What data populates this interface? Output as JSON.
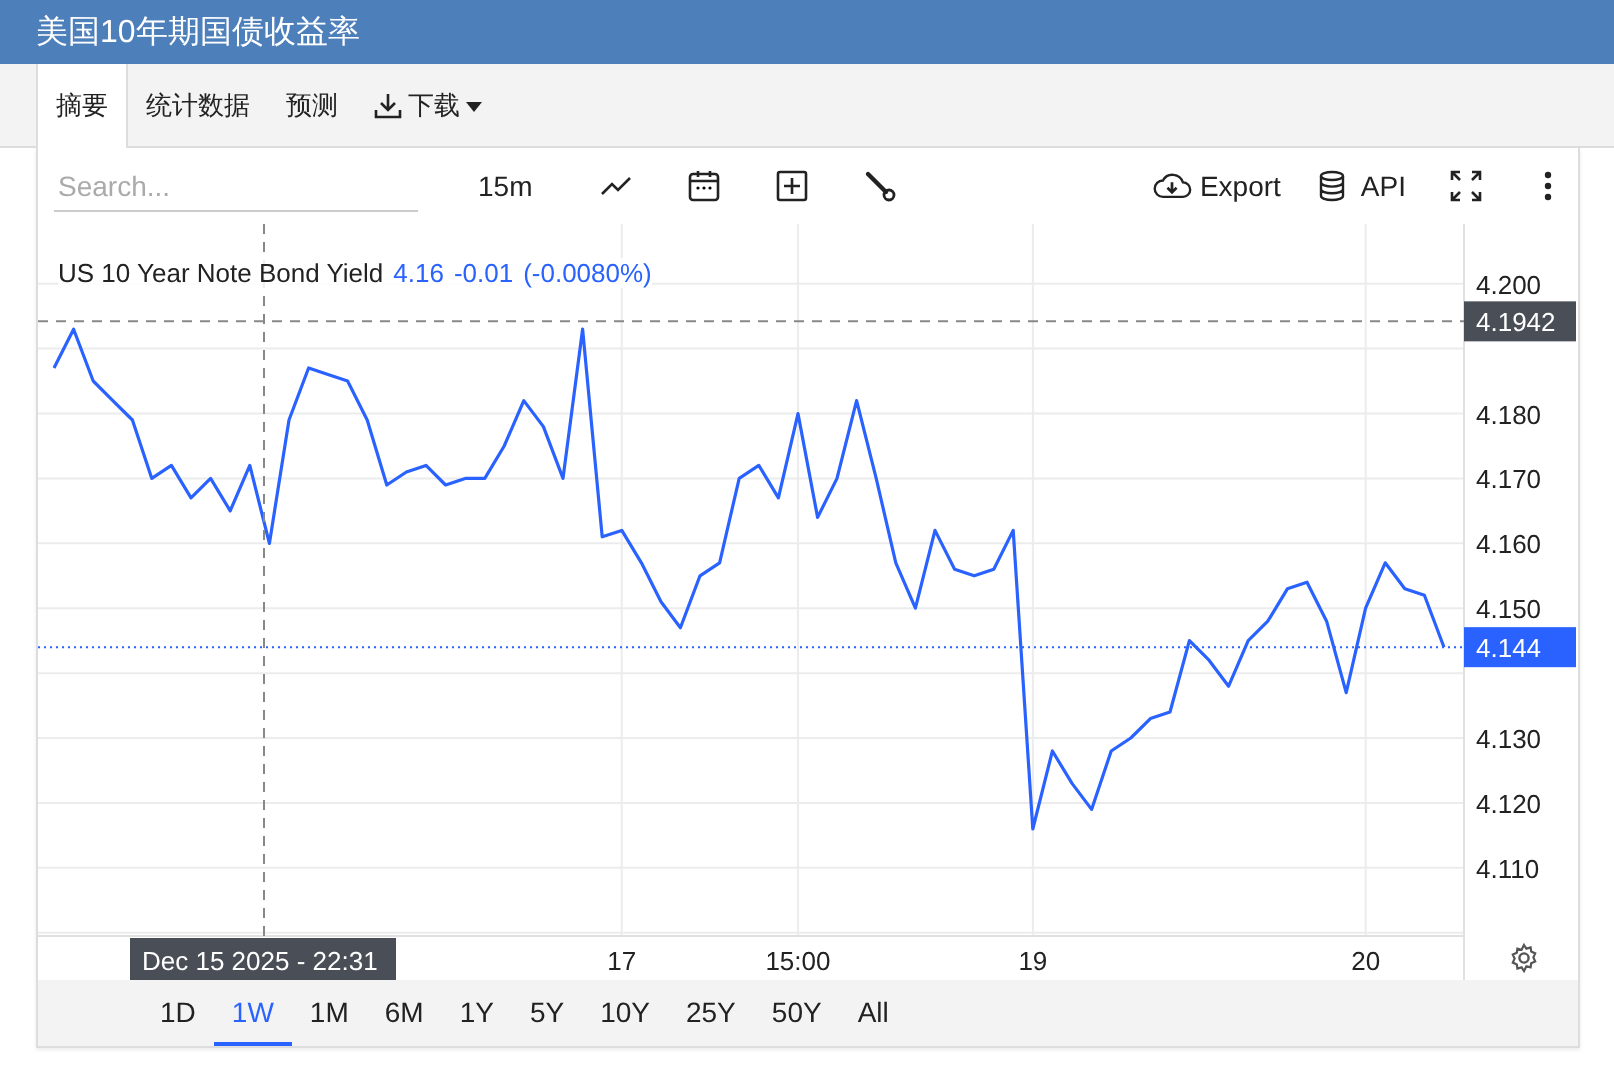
{
  "header": {
    "title": "美国10年期国债收益率"
  },
  "tabs": [
    {
      "label": "摘要",
      "selected": true
    },
    {
      "label": "统计数据",
      "selected": false
    },
    {
      "label": "预测",
      "selected": false
    },
    {
      "label": "下载",
      "selected": false,
      "kind": "download"
    }
  ],
  "toolbar": {
    "search": {
      "placeholder": "Search..."
    },
    "interval": "15m",
    "export": "Export",
    "api": "API"
  },
  "legend": {
    "name": "US 10 Year Note Bond Yield",
    "value": "4.16",
    "change": "-0.01",
    "change_pct": "(-0.0080%)"
  },
  "crosshair": {
    "time": "Dec 15 2025 - 22:31"
  },
  "chart_data": {
    "type": "line",
    "grid": true,
    "ylim": [
      4.0995,
      4.2092
    ],
    "yticks": [
      {
        "value": 4.11,
        "label": "4.110"
      },
      {
        "value": 4.12,
        "label": "4.120"
      },
      {
        "value": 4.13,
        "label": "4.130"
      },
      {
        "value": 4.15,
        "label": "4.150"
      },
      {
        "value": 4.16,
        "label": "4.160"
      },
      {
        "value": 4.17,
        "label": "4.170"
      },
      {
        "value": 4.18,
        "label": "4.180"
      },
      {
        "value": 4.2,
        "label": "4.200"
      }
    ],
    "ref_lines": [
      {
        "axis": "y",
        "value": 4.1942,
        "label": "4.1942",
        "color": "#888888"
      },
      {
        "axis": "y",
        "value": 4.144,
        "label": "4.144",
        "color": "#2962ff"
      }
    ],
    "categories": [
      null,
      null,
      null,
      null,
      null,
      null,
      null,
      null,
      null,
      null,
      null,
      null,
      null,
      null,
      null,
      null,
      null,
      null,
      null,
      null,
      null,
      null,
      null,
      null,
      null,
      null,
      null,
      null,
      null,
      "17",
      null,
      null,
      null,
      null,
      null,
      null,
      null,
      null,
      "15:00",
      null,
      null,
      null,
      null,
      null,
      null,
      null,
      null,
      null,
      null,
      null,
      "19",
      null,
      null,
      null,
      null,
      null,
      null,
      null,
      null,
      null,
      null,
      null,
      null,
      null,
      null,
      null,
      null,
      "20",
      null,
      null,
      null,
      null
    ],
    "series": [
      {
        "color": "#2962ff",
        "values": [
          4.187,
          4.193,
          4.185,
          4.182,
          4.179,
          4.17,
          4.172,
          4.167,
          4.17,
          4.165,
          4.172,
          4.16,
          4.179,
          4.187,
          4.186,
          4.185,
          4.179,
          4.169,
          4.171,
          4.172,
          4.169,
          4.17,
          4.17,
          4.175,
          4.182,
          4.178,
          4.17,
          4.193,
          4.161,
          4.162,
          4.157,
          4.151,
          4.147,
          4.155,
          4.157,
          4.17,
          4.172,
          4.167,
          4.18,
          4.164,
          4.17,
          4.182,
          4.17,
          4.157,
          4.15,
          4.162,
          4.156,
          4.155,
          4.156,
          4.162,
          4.116,
          4.128,
          4.123,
          4.119,
          4.128,
          4.13,
          4.133,
          4.134,
          4.145,
          4.142,
          4.138,
          4.145,
          4.148,
          4.153,
          4.154,
          4.148,
          4.137,
          4.15,
          4.157,
          4.153,
          4.152,
          4.144
        ]
      }
    ]
  },
  "ranges": [
    {
      "label": "1D",
      "selected": false
    },
    {
      "label": "1W",
      "selected": true
    },
    {
      "label": "1M",
      "selected": false
    },
    {
      "label": "6M",
      "selected": false
    },
    {
      "label": "1Y",
      "selected": false
    },
    {
      "label": "5Y",
      "selected": false
    },
    {
      "label": "10Y",
      "selected": false
    },
    {
      "label": "25Y",
      "selected": false
    },
    {
      "label": "50Y",
      "selected": false
    },
    {
      "label": "All",
      "selected": false
    }
  ]
}
